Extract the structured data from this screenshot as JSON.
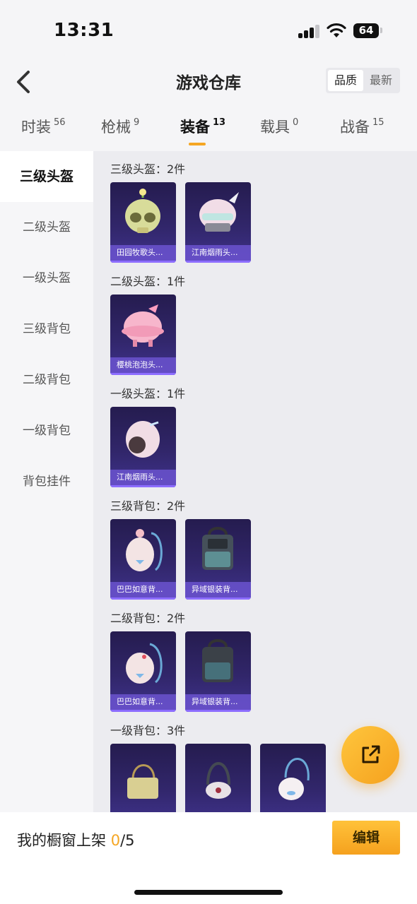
{
  "status_bar": {
    "time": "13:31",
    "battery": "64"
  },
  "header": {
    "title": "游戏仓库",
    "sort_options": [
      "品质",
      "最新"
    ]
  },
  "tabs": [
    {
      "label": "时装",
      "count": "56"
    },
    {
      "label": "枪械",
      "count": "9"
    },
    {
      "label": "装备",
      "count": "13"
    },
    {
      "label": "载具",
      "count": "0"
    },
    {
      "label": "战备",
      "count": "15"
    }
  ],
  "sidebar": {
    "items": [
      "三级头盔",
      "二级头盔",
      "一级头盔",
      "三级背包",
      "二级背包",
      "一级背包",
      "背包挂件"
    ]
  },
  "sections": [
    {
      "title": "三级头盔：2件",
      "items": [
        "田园牧歌头...",
        "江南烟雨头..."
      ]
    },
    {
      "title": "二级头盔：1件",
      "items": [
        "樱桃泡泡头..."
      ]
    },
    {
      "title": "一级头盔：1件",
      "items": [
        "江南烟雨头..."
      ]
    },
    {
      "title": "三级背包：2件",
      "items": [
        "巴巴如意背...",
        "异域银装背..."
      ]
    },
    {
      "title": "二级背包：2件",
      "items": [
        "巴巴如意背...",
        "异域银装背..."
      ]
    },
    {
      "title": "一级背包：3件",
      "items": [
        "",
        "",
        ""
      ]
    }
  ],
  "bottom": {
    "label": "我的橱窗上架",
    "count": "0",
    "total": "/5",
    "edit_label": "编辑"
  },
  "icons": {
    "back": "chevron-left-icon",
    "share": "share-external-icon"
  },
  "colors": {
    "accent": "#f5a623",
    "card_bg": "#2b2160",
    "caption_bg": "#6c54d2"
  }
}
